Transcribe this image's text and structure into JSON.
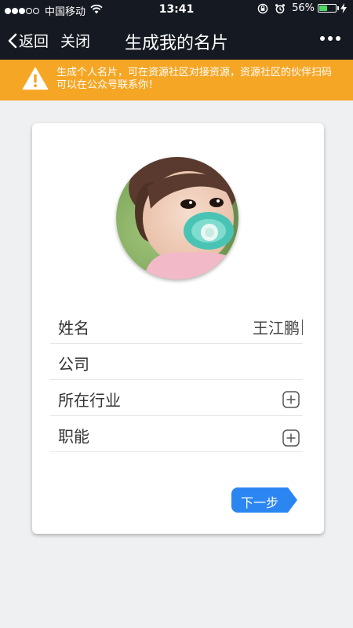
{
  "status_bar": {
    "carrier": "中国移动",
    "time": "13:41",
    "battery_percent": "56%",
    "battery_level": 0.56,
    "signal_bars_filled": 3,
    "signal_bars_total": 5
  },
  "nav": {
    "back_label": "返回",
    "close_label": "关闭",
    "title": "生成我的名片"
  },
  "notice": {
    "text": "生成个人名片，可在资源社区对接资源，资源社区的伙伴扫码可以在公众号联系你！"
  },
  "form": {
    "name_label": "姓名",
    "name_value": "王江鹏",
    "company_label": "公司",
    "company_value": "",
    "industry_label": "所在行业",
    "position_label": "职能"
  },
  "next_button": {
    "label": "下一步"
  },
  "colors": {
    "bar_background": "#151921",
    "notice_background": "#f6a625",
    "accent_blue": "#2b86f2",
    "page_background": "#eef0f1"
  }
}
